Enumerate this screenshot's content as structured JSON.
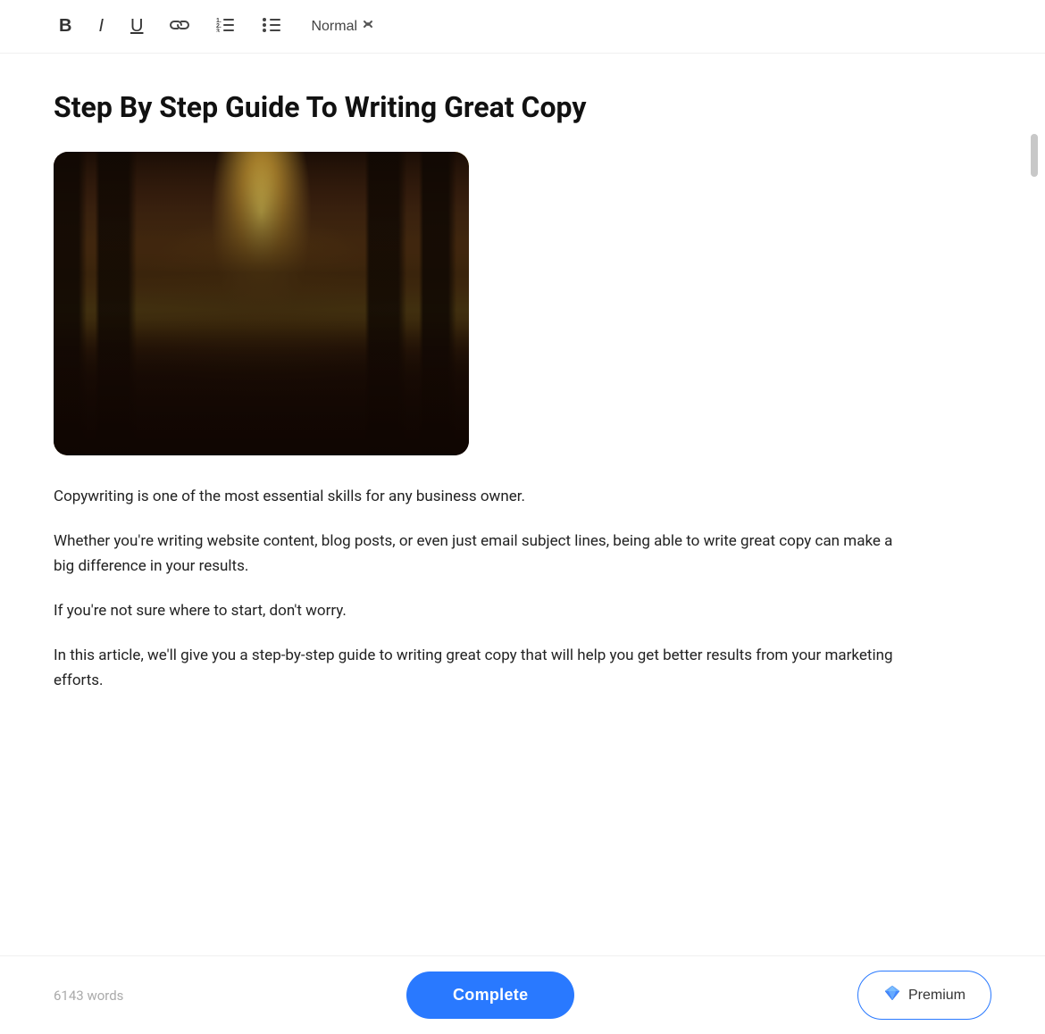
{
  "toolbar": {
    "bold_label": "B",
    "italic_label": "I",
    "underline_label": "U",
    "link_label": "🔗",
    "style_label": "Normal",
    "dropdown_arrow": "⬦"
  },
  "article": {
    "title": "Step By Step Guide To Writing Great Copy",
    "paragraphs": [
      "Copywriting is one of the most essential skills for any business owner.",
      "Whether you're writing website content, blog posts, or even just email subject lines, being able to write great copy can make a big difference in your results.",
      "If you're not sure where to start, don't worry.",
      "In this article, we'll give you a step-by-step guide to writing great copy that will help you get better results from your marketing efforts."
    ]
  },
  "bottom_bar": {
    "word_count": "6143 words",
    "complete_label": "Complete",
    "premium_label": "Premium"
  }
}
